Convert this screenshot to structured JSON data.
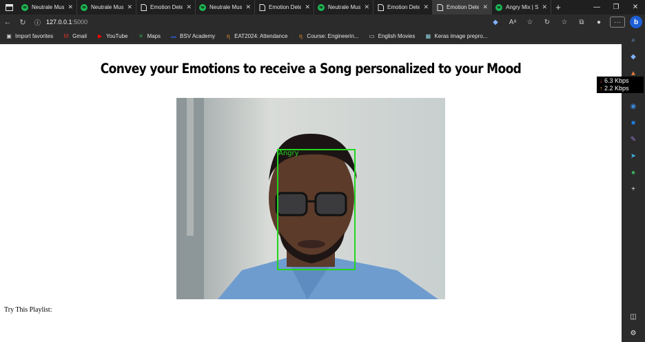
{
  "tabs": [
    {
      "label": "Neutrale Musik",
      "icon": "spotify-icon",
      "active": false
    },
    {
      "label": "Neutrale Musik",
      "icon": "spotify-icon",
      "active": false
    },
    {
      "label": "Emotion Detection",
      "icon": "page-icon",
      "active": false
    },
    {
      "label": "Neutrale Musik",
      "icon": "spotify-icon",
      "active": false
    },
    {
      "label": "Emotion Detection",
      "icon": "page-icon",
      "active": false
    },
    {
      "label": "Neutrale Musik",
      "icon": "spotify-icon",
      "active": false
    },
    {
      "label": "Emotion Detection",
      "icon": "page-icon",
      "active": false
    },
    {
      "label": "Emotion Detection",
      "icon": "page-icon",
      "active": true
    },
    {
      "label": "Angry Mix | Spotify",
      "icon": "spotify-icon",
      "active": false
    }
  ],
  "address": {
    "host": "127.0.0.1",
    "port": ":5000"
  },
  "bookmarks": [
    {
      "label": "Import favorites",
      "icon": "folder-icon"
    },
    {
      "label": "Gmail",
      "icon": "gmail-icon"
    },
    {
      "label": "YouTube",
      "icon": "youtube-icon"
    },
    {
      "label": "Maps",
      "icon": "maps-icon"
    },
    {
      "label": "BSV Academy",
      "icon": "bsv-icon"
    },
    {
      "label": "EAT2024: Attendance",
      "icon": "nptel-icon"
    },
    {
      "label": "Course: Engineerin...",
      "icon": "nptel-icon"
    },
    {
      "label": "English Movies",
      "icon": "monitor-icon"
    },
    {
      "label": "Keras image prepro...",
      "icon": "keras-icon"
    }
  ],
  "page": {
    "heading": "Convey your Emotions to receive a Song personalized to your Mood",
    "emotion_label": "Angry",
    "playlist_prompt": "Try This Playlist:"
  },
  "network": {
    "download": "6.3 Kbps",
    "upload": "2.2 Kbps"
  },
  "colors": {
    "face_box": "#22d61e",
    "spotify": "#1db954"
  }
}
